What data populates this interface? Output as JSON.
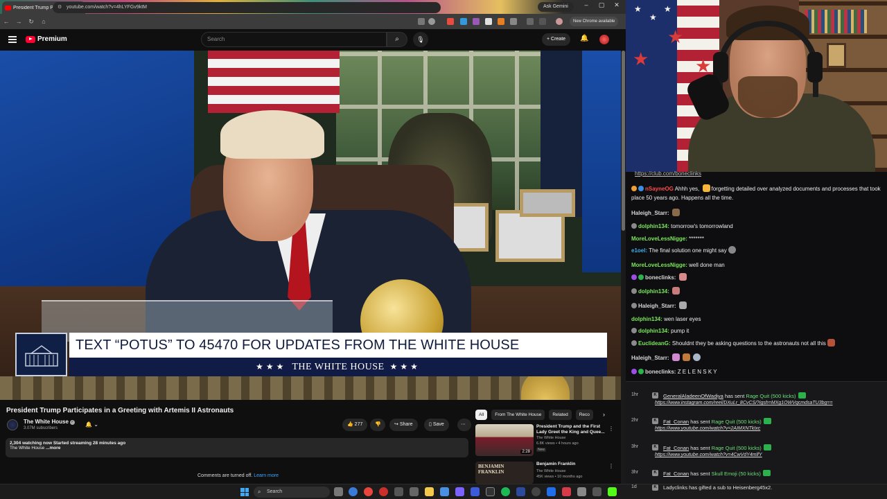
{
  "browser": {
    "tab_title": "President Trump Participat",
    "tab_close": "✕",
    "new_tab": "+",
    "ask_gemini": "Ask Gemini",
    "url": "youtube.com/watch?v=4hLYFGv9ktM",
    "chrome_available": "New Chrome available",
    "window_controls": [
      "–",
      "▢",
      "✕"
    ]
  },
  "youtube": {
    "logo_text": "Premium",
    "search_placeholder": "Search",
    "create_label": "+ Create"
  },
  "video": {
    "lower_third_top": "TEXT “POTUS” TO 45470 FOR UPDATES FROM THE WHITE HOUSE",
    "lower_third_bottom": "THE WHITE HOUSE",
    "stars": "★★★"
  },
  "watch": {
    "title": "President Trump Participates in a Greeting with Artemis II Astronauts",
    "channel_name": "The White House",
    "subscribers": "3.07M subscribers",
    "likes": "277",
    "share_label": "Share",
    "save_label": "Save",
    "description_line1": "2,304 watching now  Started streaming 28 minutes ago",
    "description_line2": "The White House",
    "description_more": "...more",
    "comments_off": "Comments are turned off.",
    "learn_more": "Learn more"
  },
  "chips": [
    "All",
    "From The White House",
    "Related",
    "Reco"
  ],
  "recommendations": [
    {
      "title": "President Trump and the First Lady Greet the King and Quee...",
      "channel": "The White House",
      "meta": "6.8K views • 4 hours ago",
      "badge": "New",
      "duration": "2:28"
    },
    {
      "title": "Benjamin Franklin",
      "channel": "The White House",
      "meta": "45K views • 10 months ago",
      "thumb_text": "BENJAMIN FRANKLIN"
    }
  ],
  "chat": {
    "top_link": "https://club.com/boneclinks",
    "messages": [
      {
        "user": "nSayneOG",
        "user_color": "#ff4b4b",
        "text": "Ahhh yes, ",
        "text2": "forgetting detailed over analyzed documents and processes that took place 50 years ago. Happens all the time."
      },
      {
        "user": "Haleigh_Starr:",
        "user_color": "#d7d7d7",
        "text": ""
      },
      {
        "user": "dolphin134:",
        "user_color": "#7be85a",
        "text": "tomorrow's tomorrowland"
      },
      {
        "user": "MoreLoveLessNigge:",
        "user_color": "#7be85a",
        "text": "*******"
      },
      {
        "user": "e1oel:",
        "user_color": "#3cb0e8",
        "text": "The final solution one might say"
      },
      {
        "user": "MoreLoveLessNigge:",
        "user_color": "#7be85a",
        "text": "well done man"
      },
      {
        "user": "boneclinks:",
        "user_color": "#d7d7d7",
        "text": ""
      },
      {
        "user": "dolphin134:",
        "user_color": "#7be85a",
        "text": ""
      },
      {
        "user": "Haleigh_Starr:",
        "user_color": "#d7d7d7",
        "text": ""
      },
      {
        "user": "dolphin134:",
        "user_color": "#7be85a",
        "text": "wen laser eyes"
      },
      {
        "user": "dolphin134:",
        "user_color": "#7be85a",
        "text": "pump it"
      },
      {
        "user": "EuclideanG:",
        "user_color": "#7be85a",
        "text": "Shouldnt they be asking questions to the astronauts not all this"
      },
      {
        "user": "Haleigh_Starr:",
        "user_color": "#d7d7d7",
        "text": ""
      },
      {
        "user": "boneclinks:",
        "user_color": "#d7d7d7",
        "text": "Z E L E N S K Y"
      }
    ]
  },
  "events": [
    {
      "time": "1hr",
      "name": "GeneralAladeenOfWadiya",
      "action": "has sent",
      "thing": "Rage Quit (500 kicks)",
      "url": "https://www.instagram.com/reel/DXuLr_8CvCS/?igsh=MXg1OWVqcmdsaTU3bg=="
    },
    {
      "time": "2hr",
      "name": "Fat_Conan",
      "action": "has sent",
      "thing": "Rage Quit (500 kicks)",
      "url": "https://www.youtube.com/watch?v=2AIMXNTkIxc"
    },
    {
      "time": "3hr",
      "name": "Fat_Conan",
      "action": "has sent",
      "thing": "Rage Quit (500 kicks)",
      "url": "https://www.youtube.com/watch?v=4CwVdY4mlfY"
    },
    {
      "time": "3hr",
      "name": "Fat_Conan",
      "action": "has sent",
      "thing": "Skull Emoji (50 kicks)",
      "url": ""
    },
    {
      "time": "1d",
      "name": "Ladyclinks",
      "action": "has gifted a sub to",
      "thing": "Heisenberg45x2.",
      "url": ""
    }
  ],
  "taskbar": {
    "search_placeholder": "Search"
  },
  "colors": {
    "yt_red": "#ff0033",
    "link_blue": "#3ea6ff",
    "kick_green": "#2bb24c",
    "wh_navy": "#101b46"
  }
}
